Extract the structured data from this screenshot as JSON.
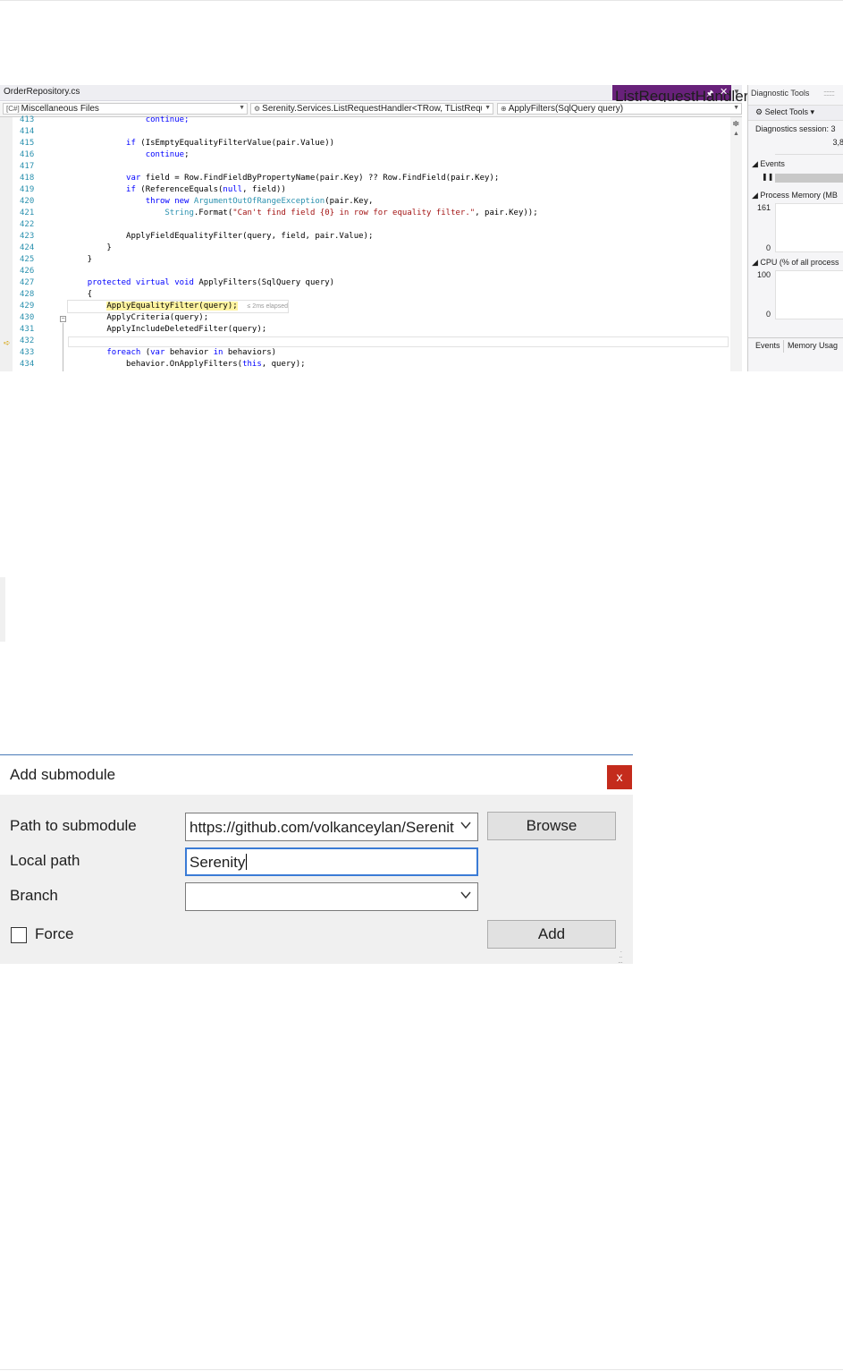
{
  "vs": {
    "tabs": {
      "inactive": "OrderRepository.cs",
      "active": "ListRequestHandler.cs",
      "pin_icon": "pin-icon",
      "close_icon": "close-icon"
    },
    "nav": {
      "project": "Miscellaneous Files",
      "type": "Serenity.Services.ListRequestHandler<TRow, TListReque:",
      "member": "ApplyFilters(SqlQuery query)"
    },
    "lines": [
      {
        "num": "413",
        "segments": [
          {
            "t": "                continue;",
            "c": "kw"
          }
        ]
      },
      {
        "num": "414",
        "segments": []
      },
      {
        "num": "415",
        "segments": [
          {
            "t": "            "
          },
          {
            "t": "if",
            "c": "kw"
          },
          {
            "t": " (IsEmptyEqualityFilterValue(pair.Value))"
          }
        ]
      },
      {
        "num": "416",
        "segments": [
          {
            "t": "                "
          },
          {
            "t": "continue",
            "c": "kw"
          },
          {
            "t": ";"
          }
        ]
      },
      {
        "num": "417",
        "segments": []
      },
      {
        "num": "418",
        "segments": [
          {
            "t": "            "
          },
          {
            "t": "var",
            "c": "kw"
          },
          {
            "t": " field = Row.FindFieldByPropertyName(pair.Key) ?? Row.FindField(pair.Key);"
          }
        ]
      },
      {
        "num": "419",
        "segments": [
          {
            "t": "            "
          },
          {
            "t": "if",
            "c": "kw"
          },
          {
            "t": " (ReferenceEquals("
          },
          {
            "t": "null",
            "c": "kw"
          },
          {
            "t": ", field))"
          }
        ]
      },
      {
        "num": "420",
        "segments": [
          {
            "t": "                "
          },
          {
            "t": "throw",
            "c": "kw"
          },
          {
            "t": " "
          },
          {
            "t": "new",
            "c": "kw"
          },
          {
            "t": " "
          },
          {
            "t": "ArgumentOutOfRangeException",
            "c": "ty"
          },
          {
            "t": "(pair.Key,"
          }
        ]
      },
      {
        "num": "421",
        "segments": [
          {
            "t": "                    "
          },
          {
            "t": "String",
            "c": "ty"
          },
          {
            "t": ".Format("
          },
          {
            "t": "\"Can't find field {0} in row for equality filter.\"",
            "c": "st"
          },
          {
            "t": ", pair.Key));"
          }
        ]
      },
      {
        "num": "422",
        "segments": []
      },
      {
        "num": "423",
        "segments": [
          {
            "t": "            ApplyFieldEqualityFilter(query, field, pair.Value);"
          }
        ]
      },
      {
        "num": "424",
        "segments": [
          {
            "t": "        }"
          }
        ]
      },
      {
        "num": "425",
        "segments": [
          {
            "t": "    }"
          }
        ]
      },
      {
        "num": "426",
        "segments": []
      },
      {
        "num": "427",
        "segments": [
          {
            "t": "    "
          },
          {
            "t": "protected",
            "c": "kw"
          },
          {
            "t": " "
          },
          {
            "t": "virtual",
            "c": "kw"
          },
          {
            "t": " "
          },
          {
            "t": "void",
            "c": "kw"
          },
          {
            "t": " ApplyFilters(SqlQuery query)"
          }
        ]
      },
      {
        "num": "428",
        "segments": [
          {
            "t": "    {"
          }
        ]
      },
      {
        "num": "429",
        "current": true,
        "segments": [
          {
            "t": "        "
          },
          {
            "t": "ApplyEqualityFilter(query);",
            "c": "hl"
          },
          {
            "t": "  "
          },
          {
            "t": "≤ 2ms elapsed",
            "c": "elapsed"
          }
        ]
      },
      {
        "num": "430",
        "segments": [
          {
            "t": "        ApplyCriteria(query);"
          }
        ]
      },
      {
        "num": "431",
        "segments": [
          {
            "t": "        ApplyIncludeDeletedFilter(query);"
          }
        ]
      },
      {
        "num": "432",
        "segments": []
      },
      {
        "num": "433",
        "segments": [
          {
            "t": "        "
          },
          {
            "t": "foreach",
            "c": "kw"
          },
          {
            "t": " ("
          },
          {
            "t": "var",
            "c": "kw"
          },
          {
            "t": " behavior "
          },
          {
            "t": "in",
            "c": "kw"
          },
          {
            "t": " behaviors)"
          }
        ]
      },
      {
        "num": "434",
        "segments": [
          {
            "t": "            behavior.OnApplyFilters("
          },
          {
            "t": "this",
            "c": "kw"
          },
          {
            "t": ", query);"
          }
        ]
      }
    ],
    "diag": {
      "title": "Diagnostic Tools",
      "select_tools": "Select Tools",
      "session": "Diagnostics session: 3",
      "timeline_value": "3,8",
      "events": "Events",
      "process_memory": "Process Memory (MB",
      "mem_max": "161",
      "mem_min": "0",
      "cpu": "CPU (% of all process",
      "cpu_max": "100",
      "cpu_min": "0",
      "tab_events": "Events",
      "tab_memory": "Memory Usag"
    }
  },
  "dialog": {
    "title": "Add submodule",
    "close": "x",
    "path_label": "Path to submodule",
    "path_value": "https://github.com/volkanceylan/Serenity",
    "browse": "Browse",
    "local_label": "Local path",
    "local_value": "Serenity",
    "branch_label": "Branch",
    "branch_value": "",
    "force_label": "Force",
    "force_checked": false,
    "add": "Add"
  }
}
